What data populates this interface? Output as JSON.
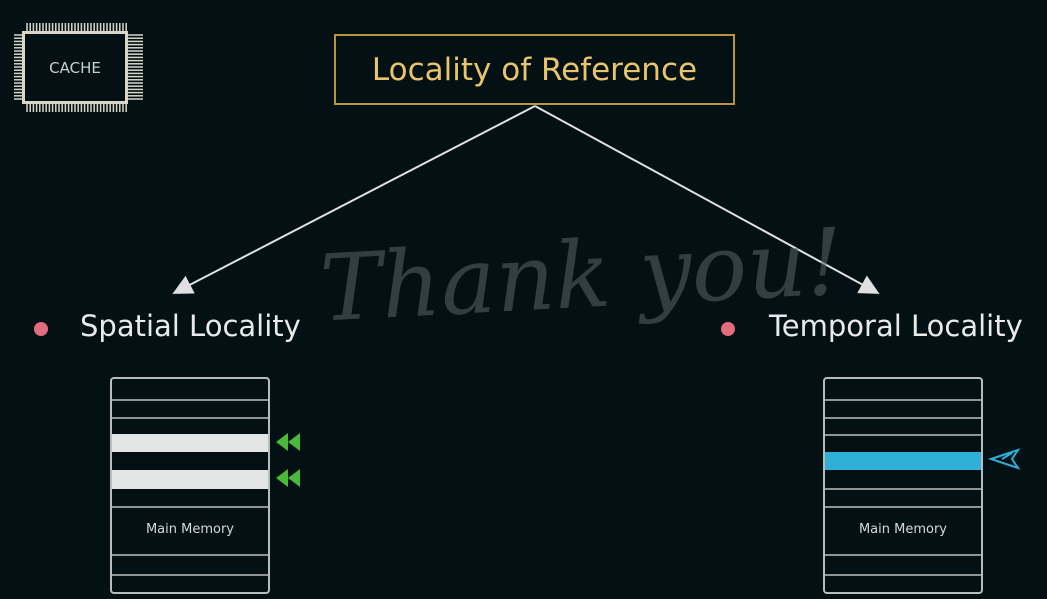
{
  "cache_label": "CACHE",
  "title": "Locality of Reference",
  "watermark": "Thank you!",
  "left": {
    "heading": "Spatial Locality",
    "memory_label": "Main Memory"
  },
  "right": {
    "heading": "Temporal Locality",
    "memory_label": "Main Memory"
  },
  "colors": {
    "background": "#041114",
    "title": "#e8c46a",
    "bullet": "#e26c7c",
    "spatial_arrow": "#4cb83a",
    "temporal_highlight": "#2fb0d8"
  }
}
